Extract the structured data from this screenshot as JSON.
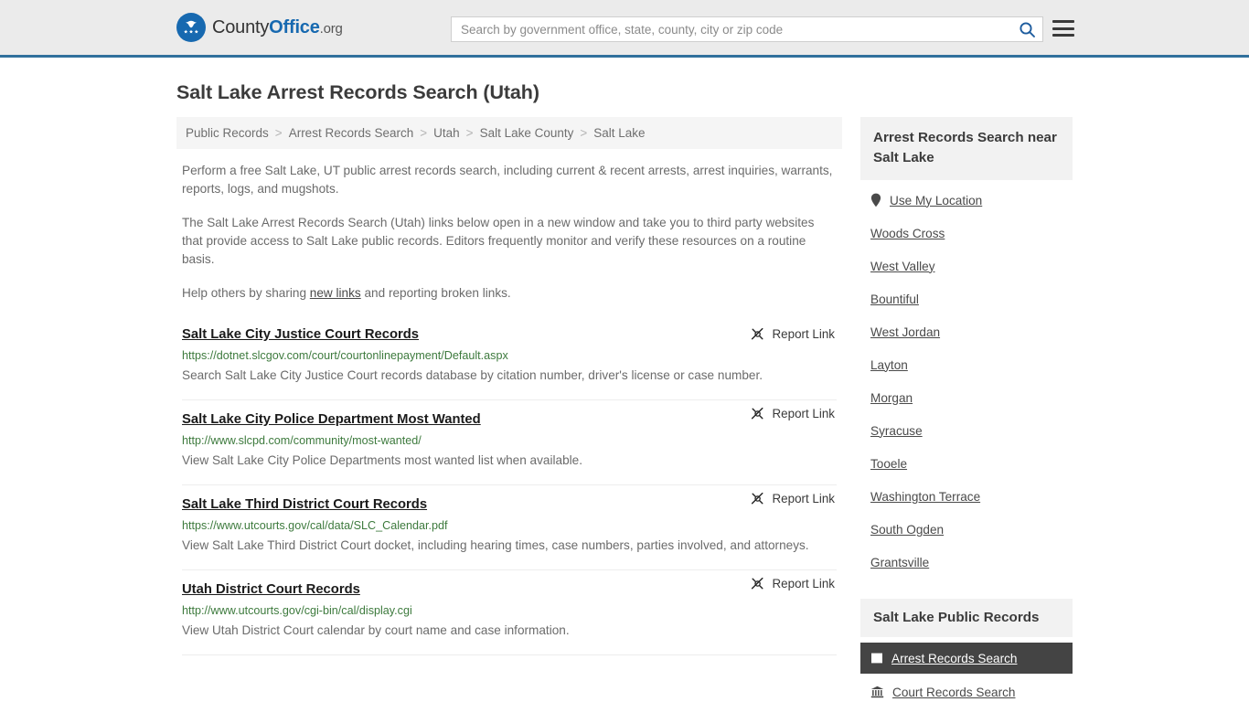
{
  "header": {
    "logo": {
      "part1": "County",
      "part2": "Office",
      "part3": ".org",
      "icon": "eagle-stars-logo-icon"
    },
    "search": {
      "placeholder": "Search by government office, state, county, city or zip code",
      "value": "",
      "search_icon": "search-icon"
    },
    "menu_icon": "hamburger-menu-icon",
    "accent_color": "#31709c",
    "background_color": "#ebebeb"
  },
  "page": {
    "title": "Salt Lake Arrest Records Search (Utah)"
  },
  "breadcrumb": {
    "separator": ">",
    "items": [
      {
        "label": "Public Records"
      },
      {
        "label": "Arrest Records Search"
      },
      {
        "label": "Utah"
      },
      {
        "label": "Salt Lake County"
      },
      {
        "label": "Salt Lake"
      }
    ]
  },
  "intro": {
    "p1": "Perform a free Salt Lake, UT public arrest records search, including current & recent arrests, arrest inquiries, warrants, reports, logs, and mugshots.",
    "p2": "The Salt Lake Arrest Records Search (Utah) links below open in a new window and take you to third party websites that provide access to Salt Lake public records. Editors frequently monitor and verify these resources on a routine basis.",
    "p3_before": "Help others by sharing ",
    "p3_link": "new links",
    "p3_after": " and reporting broken links."
  },
  "results": {
    "report_label": "Report Link",
    "report_icon": "broken-link-icon",
    "items": [
      {
        "title": "Salt Lake City Justice Court Records",
        "url": "https://dotnet.slcgov.com/court/courtonlinepayment/Default.aspx",
        "description": "Search Salt Lake City Justice Court records database by citation number, driver's license or case number."
      },
      {
        "title": "Salt Lake City Police Department Most Wanted",
        "url": "http://www.slcpd.com/community/most-wanted/",
        "description": "View Salt Lake City Police Departments most wanted list when available."
      },
      {
        "title": "Salt Lake Third District Court Records",
        "url": "https://www.utcourts.gov/cal/data/SLC_Calendar.pdf",
        "description": "View Salt Lake Third District Court docket, including hearing times, case numbers, parties involved, and attorneys."
      },
      {
        "title": "Utah District Court Records",
        "url": "http://www.utcourts.gov/cgi-bin/cal/display.cgi",
        "description": "View Utah District Court calendar by court name and case information."
      }
    ]
  },
  "sidebar": {
    "nearby": {
      "header": "Arrest Records Search near Salt Lake",
      "use_my_location": {
        "label": "Use My Location",
        "icon": "map-pin-icon"
      },
      "cities": [
        {
          "label": "Woods Cross"
        },
        {
          "label": "West Valley"
        },
        {
          "label": "Bountiful"
        },
        {
          "label": "West Jordan"
        },
        {
          "label": "Layton"
        },
        {
          "label": "Morgan"
        },
        {
          "label": "Syracuse"
        },
        {
          "label": "Tooele"
        },
        {
          "label": "Washington Terrace"
        },
        {
          "label": "South Ogden"
        },
        {
          "label": "Grantsville"
        }
      ]
    },
    "public_records": {
      "header": "Salt Lake Public Records",
      "items": [
        {
          "label": "Arrest Records Search",
          "icon": "id-card-icon",
          "active": true
        },
        {
          "label": "Court Records Search",
          "icon": "courthouse-icon",
          "active": false
        }
      ]
    }
  }
}
